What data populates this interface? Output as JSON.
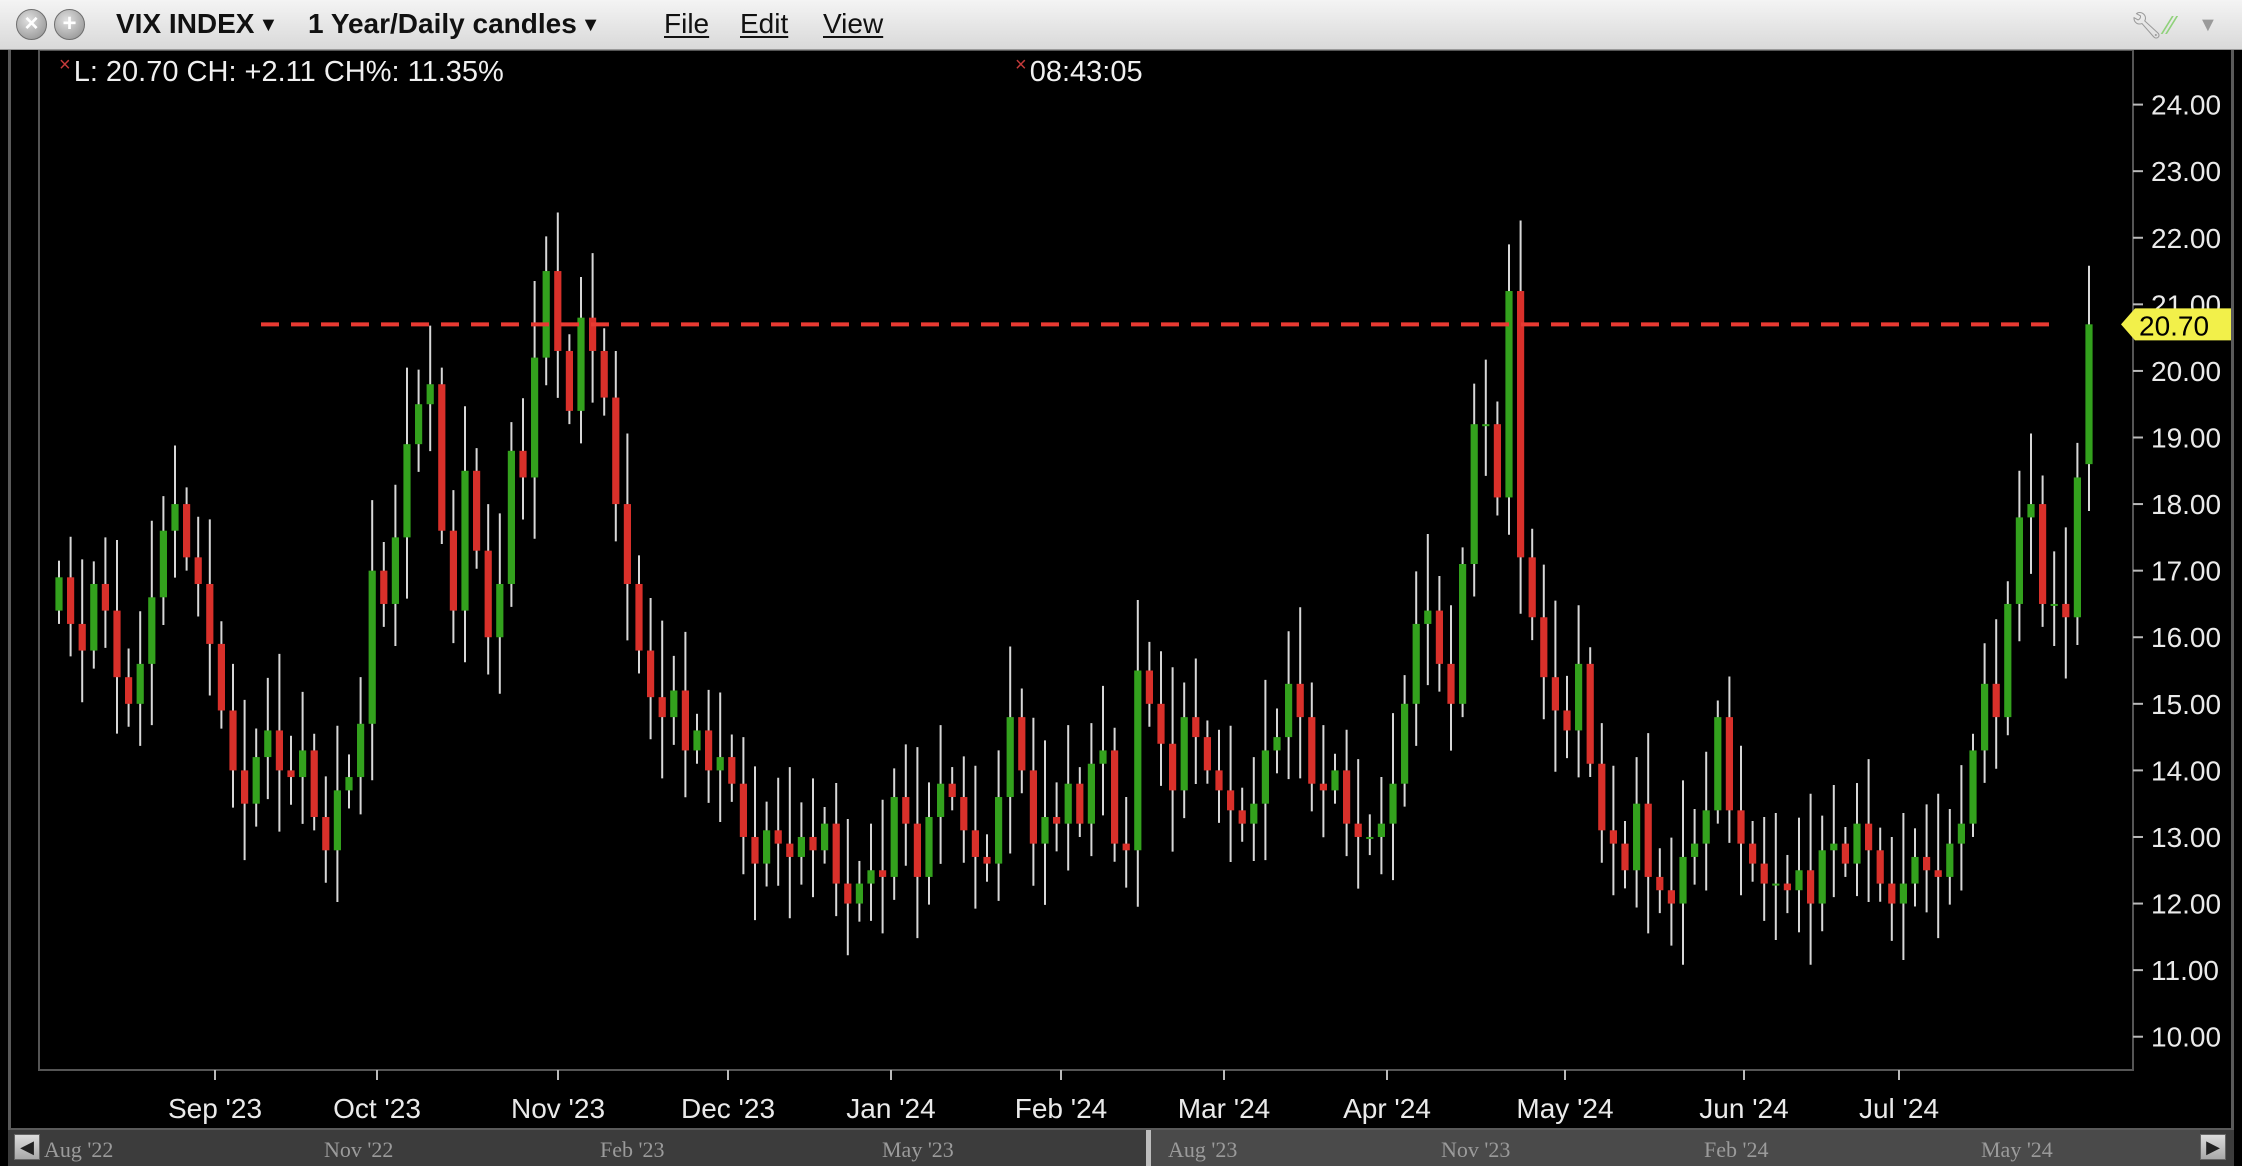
{
  "window": {
    "symbol": "VIX INDEX",
    "period": "1 Year/Daily candles",
    "menu": [
      "File",
      "Edit",
      "View"
    ]
  },
  "readout": {
    "ohlc": "L: 20.70 CH: +2.11 CH%: 11.35%",
    "time": "08:43:05"
  },
  "colors": {
    "up": "#33a11d",
    "down": "#d9302a",
    "reference_line": "#e83a32",
    "price_tag": "#f2f04a",
    "background": "#000000"
  },
  "chart_data": {
    "type": "candlestick",
    "ylim": [
      9.5,
      24.7
    ],
    "yticks": [
      "24.00",
      "23.00",
      "22.00",
      "21.00",
      "20.00",
      "19.00",
      "18.00",
      "17.00",
      "16.00",
      "15.00",
      "14.00",
      "13.00",
      "12.00",
      "11.00",
      "10.00"
    ],
    "xticks": [
      "Sep '23",
      "Oct '23",
      "Nov '23",
      "Dec '23",
      "Jan '24",
      "Feb '24",
      "Mar '24",
      "Apr '24",
      "May '24",
      "Jun '24",
      "Jul '24"
    ],
    "last_price": "20.70",
    "reference_level": 20.7,
    "closes": [
      16.9,
      16.2,
      15.8,
      16.8,
      16.4,
      15.4,
      15.0,
      15.6,
      16.6,
      17.6,
      18.0,
      17.2,
      16.8,
      15.9,
      14.9,
      14.0,
      13.5,
      14.2,
      14.6,
      14.0,
      13.9,
      14.3,
      13.3,
      12.8,
      13.7,
      13.9,
      14.7,
      17.0,
      16.5,
      17.5,
      18.9,
      19.5,
      19.8,
      17.6,
      16.4,
      18.5,
      17.3,
      16.0,
      16.8,
      18.8,
      18.4,
      20.2,
      21.5,
      20.3,
      19.4,
      20.8,
      20.3,
      19.6,
      18.0,
      16.8,
      15.8,
      15.1,
      14.8,
      15.2,
      14.3,
      14.6,
      14.0,
      14.2,
      13.8,
      13.0,
      12.6,
      13.1,
      12.9,
      12.7,
      13.0,
      12.8,
      13.2,
      12.3,
      12.0,
      12.3,
      12.5,
      12.4,
      13.6,
      13.2,
      12.4,
      13.3,
      13.8,
      13.6,
      13.1,
      12.7,
      12.6,
      13.6,
      14.8,
      14.0,
      12.9,
      13.3,
      13.2,
      13.8,
      13.2,
      14.1,
      14.3,
      12.9,
      12.8,
      15.5,
      15.0,
      14.4,
      13.7,
      14.8,
      14.5,
      14.0,
      13.7,
      13.4,
      13.2,
      13.5,
      14.3,
      14.5,
      15.3,
      14.8,
      13.8,
      13.7,
      14.0,
      13.2,
      13.0,
      13.0,
      13.2,
      13.8,
      15.0,
      16.2,
      16.4,
      15.6,
      15.0,
      17.1,
      19.2,
      19.2,
      18.1,
      21.2,
      17.2,
      16.3,
      15.4,
      14.9,
      14.6,
      15.6,
      14.1,
      13.1,
      12.9,
      12.5,
      13.5,
      12.4,
      12.2,
      12.0,
      12.7,
      12.9,
      13.4,
      14.8,
      13.4,
      12.9,
      12.6,
      12.3,
      12.3,
      12.2,
      12.5,
      12.0,
      12.8,
      12.9,
      12.6,
      13.2,
      12.8,
      12.3,
      12.0,
      12.3,
      12.7,
      12.5,
      12.4,
      12.9,
      13.2,
      14.3,
      15.3,
      14.8,
      16.5,
      17.8,
      18.0,
      16.5,
      16.5,
      16.3,
      18.4,
      20.7
    ],
    "opens": [
      16.4,
      16.9,
      16.2,
      15.8,
      16.8,
      16.4,
      15.4,
      15.0,
      15.6,
      16.6,
      17.6,
      18.0,
      17.2,
      16.8,
      15.9,
      14.9,
      14.0,
      13.5,
      14.2,
      14.6,
      14.0,
      13.9,
      14.3,
      13.3,
      12.8,
      13.7,
      13.9,
      14.7,
      17.0,
      16.5,
      17.5,
      18.9,
      19.5,
      19.8,
      17.6,
      16.4,
      18.5,
      17.3,
      16.0,
      16.8,
      18.8,
      18.4,
      20.2,
      21.5,
      20.3,
      19.4,
      20.8,
      20.3,
      19.6,
      18.0,
      16.8,
      15.8,
      15.1,
      14.8,
      15.2,
      14.3,
      14.6,
      14.0,
      14.2,
      13.8,
      13.0,
      12.6,
      13.1,
      12.9,
      12.7,
      13.0,
      12.8,
      13.2,
      12.3,
      12.0,
      12.3,
      12.5,
      12.4,
      13.6,
      13.2,
      12.4,
      13.3,
      13.8,
      13.6,
      13.1,
      12.7,
      12.6,
      13.6,
      14.8,
      14.0,
      12.9,
      13.3,
      13.2,
      13.8,
      13.2,
      14.1,
      14.3,
      12.9,
      12.8,
      15.5,
      15.0,
      14.4,
      13.7,
      14.8,
      14.5,
      14.0,
      13.7,
      13.4,
      13.2,
      13.5,
      14.3,
      14.5,
      15.3,
      14.8,
      13.8,
      13.7,
      14.0,
      13.2,
      13.0,
      13.0,
      13.2,
      13.8,
      15.0,
      16.2,
      16.4,
      15.6,
      15.0,
      17.1,
      19.2,
      19.2,
      18.1,
      21.2,
      17.2,
      16.3,
      15.4,
      14.9,
      14.6,
      15.6,
      14.1,
      13.1,
      12.9,
      12.5,
      13.5,
      12.4,
      12.2,
      12.0,
      12.7,
      12.9,
      13.4,
      14.8,
      13.4,
      12.9,
      12.6,
      12.3,
      12.3,
      12.2,
      12.5,
      12.0,
      12.8,
      12.9,
      12.6,
      13.2,
      12.8,
      12.3,
      12.0,
      12.3,
      12.7,
      12.5,
      12.4,
      12.9,
      13.2,
      14.3,
      15.3,
      14.8,
      16.5,
      17.8,
      18.0,
      16.5,
      16.5,
      16.3,
      18.6
    ]
  },
  "navigator": {
    "labels": [
      "Aug '22",
      "Nov '22",
      "Feb '23",
      "May '23",
      "Aug '23",
      "Nov '23",
      "Feb '24",
      "May '24"
    ]
  }
}
